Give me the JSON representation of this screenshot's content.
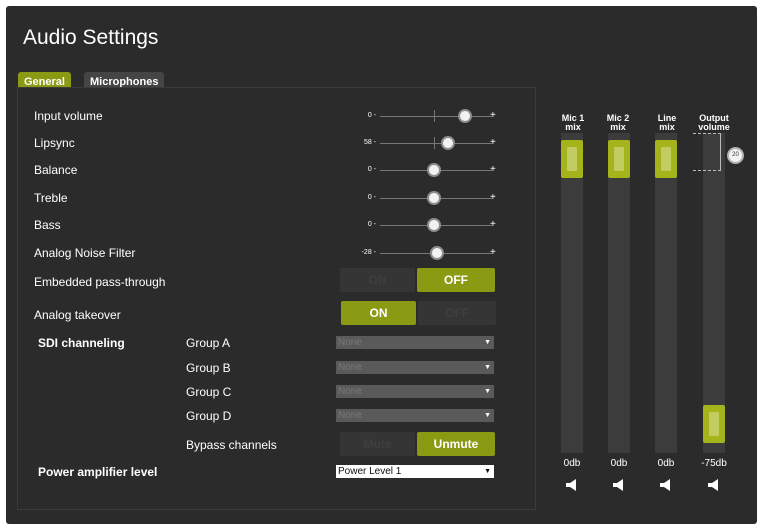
{
  "title": "Audio Settings",
  "tabs": [
    {
      "label": "General",
      "active": true
    },
    {
      "label": "Microphones",
      "active": false
    }
  ],
  "sliders": [
    {
      "label": "Input volume",
      "value": "0 -",
      "plus": "+"
    },
    {
      "label": "Lipsync",
      "value": "58 -",
      "plus": "+"
    },
    {
      "label": "Balance",
      "value": "0 -",
      "plus": "+"
    },
    {
      "label": "Treble",
      "value": "0 -",
      "plus": "+"
    },
    {
      "label": "Bass",
      "value": "0 -",
      "plus": "+"
    },
    {
      "label": "Analog Noise Filter",
      "value": "-28 -",
      "plus": "+"
    }
  ],
  "toggles": {
    "embedded": {
      "label": "Embedded pass-through",
      "on": "ON",
      "off": "OFF",
      "selected": "OFF"
    },
    "analog": {
      "label": "Analog takeover",
      "on": "ON",
      "off": "OFF",
      "selected": "ON"
    }
  },
  "sdi": {
    "label": "SDI channeling",
    "groups": [
      {
        "label": "Group A",
        "value": "None"
      },
      {
        "label": "Group B",
        "value": "None"
      },
      {
        "label": "Group C",
        "value": "None"
      },
      {
        "label": "Group D",
        "value": "None"
      }
    ],
    "bypass": {
      "label": "Bypass channels",
      "mute": "Mute",
      "unmute": "Unmute",
      "selected": "Unmute"
    }
  },
  "power": {
    "label": "Power amplifier level",
    "value": "Power Level 1"
  },
  "faders": [
    {
      "label_line1": "Mic 1",
      "label_line2": "mix",
      "db": "0db"
    },
    {
      "label_line1": "Mic 2",
      "label_line2": "mix",
      "db": "0db"
    },
    {
      "label_line1": "Line",
      "label_line2": "mix",
      "db": "0db"
    },
    {
      "label_line1": "Output",
      "label_line2": "volume",
      "db": "-75db",
      "knob": "20"
    }
  ],
  "colors": {
    "accent": "#8a9a12",
    "background": "#2b2b2b"
  },
  "icons": {
    "speaker": "speaker-icon",
    "dropdown": "chevron-down-icon"
  }
}
